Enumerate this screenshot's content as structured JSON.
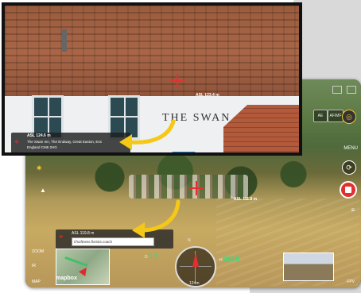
{
  "inset": {
    "sign_text": "THE SWAN",
    "asl_label": "ASL 124.6 m",
    "address_line1": "The Swan Inn, The Endway, Great Easton, Ess",
    "address_line2": "England CM6 2HG",
    "target_label": "ASL 123.4 m"
  },
  "main": {
    "menu_label": "MENU",
    "center_label": "ASL 111.8 m",
    "asl_label": "ASL 119.8 m",
    "address_value": "///softness.florists.coach",
    "zoom_label": "ZOOM",
    "map_label": "MAP",
    "fpv_label": "FPV",
    "mapbox_label": "mapbox",
    "btn_ae": "AE",
    "btn_af": "AF/MF",
    "compass_n": "N",
    "dist_label": "124m",
    "alt_label": "H",
    "alt_value": "080.5",
    "speed_label": "D",
    "speed_value": "0.1"
  },
  "colors": {
    "crosshair": "#e53030",
    "arrow": "#f5c818",
    "record": "#e03030",
    "telemetry_green": "#2fe080"
  }
}
